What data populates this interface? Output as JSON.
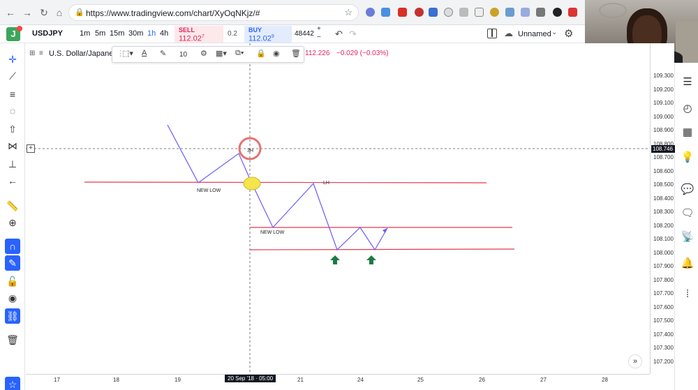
{
  "browser": {
    "url": "https://www.tradingview.com/chart/XyOqNKjz/#"
  },
  "toolbar": {
    "symbol": "USDJPY",
    "timeframes": [
      "1m",
      "5m",
      "15m",
      "30m",
      "1h",
      "4h"
    ],
    "active_timeframe": "1h",
    "sell_label": "SELL",
    "sell_price": "112.02",
    "sell_price_sup": "7",
    "spread": "0.2",
    "buy_label": "BUY",
    "buy_price": "112.02",
    "buy_price_sup": "9",
    "quantity": "48442",
    "qty_plus": "+",
    "qty_minus": "−",
    "layout_name": "Unnamed"
  },
  "drawing_toolbar": {
    "line_size": "10"
  },
  "legend": {
    "title": "U.S. Dollar/Japane",
    "price": "112.226",
    "change": "−0.029 (−0.03%)"
  },
  "price_axis": {
    "labels": [
      "109.300",
      "109.200",
      "109.100",
      "109.000",
      "108.900",
      "108.800",
      "108.700",
      "108.600",
      "108.500",
      "108.400",
      "108.300",
      "108.200",
      "108.100",
      "108.000",
      "107.900",
      "107.800",
      "107.700",
      "107.600",
      "107.500",
      "107.400",
      "107.300",
      "107.200"
    ],
    "current": "108.746"
  },
  "time_axis": {
    "labels": [
      "17",
      "18",
      "19",
      "21",
      "24",
      "25",
      "26",
      "27",
      "28"
    ],
    "crosshair_time": "20 Sep '18 · 05:00"
  },
  "annotations": {
    "new_low_1": "NEW LOW",
    "new_low_2": "NEW LOW",
    "lh": "LH",
    "hh_circle": "3H"
  },
  "colors": {
    "accent": "#2962ff",
    "sell": "#e0245e",
    "buy": "#2962ff",
    "level_line": "#e53950",
    "zigzag": "#6b5cf6",
    "arrow_up": "#1e7a43",
    "highlight_yellow": "#f5e44a",
    "circle_red": "#e57373"
  }
}
